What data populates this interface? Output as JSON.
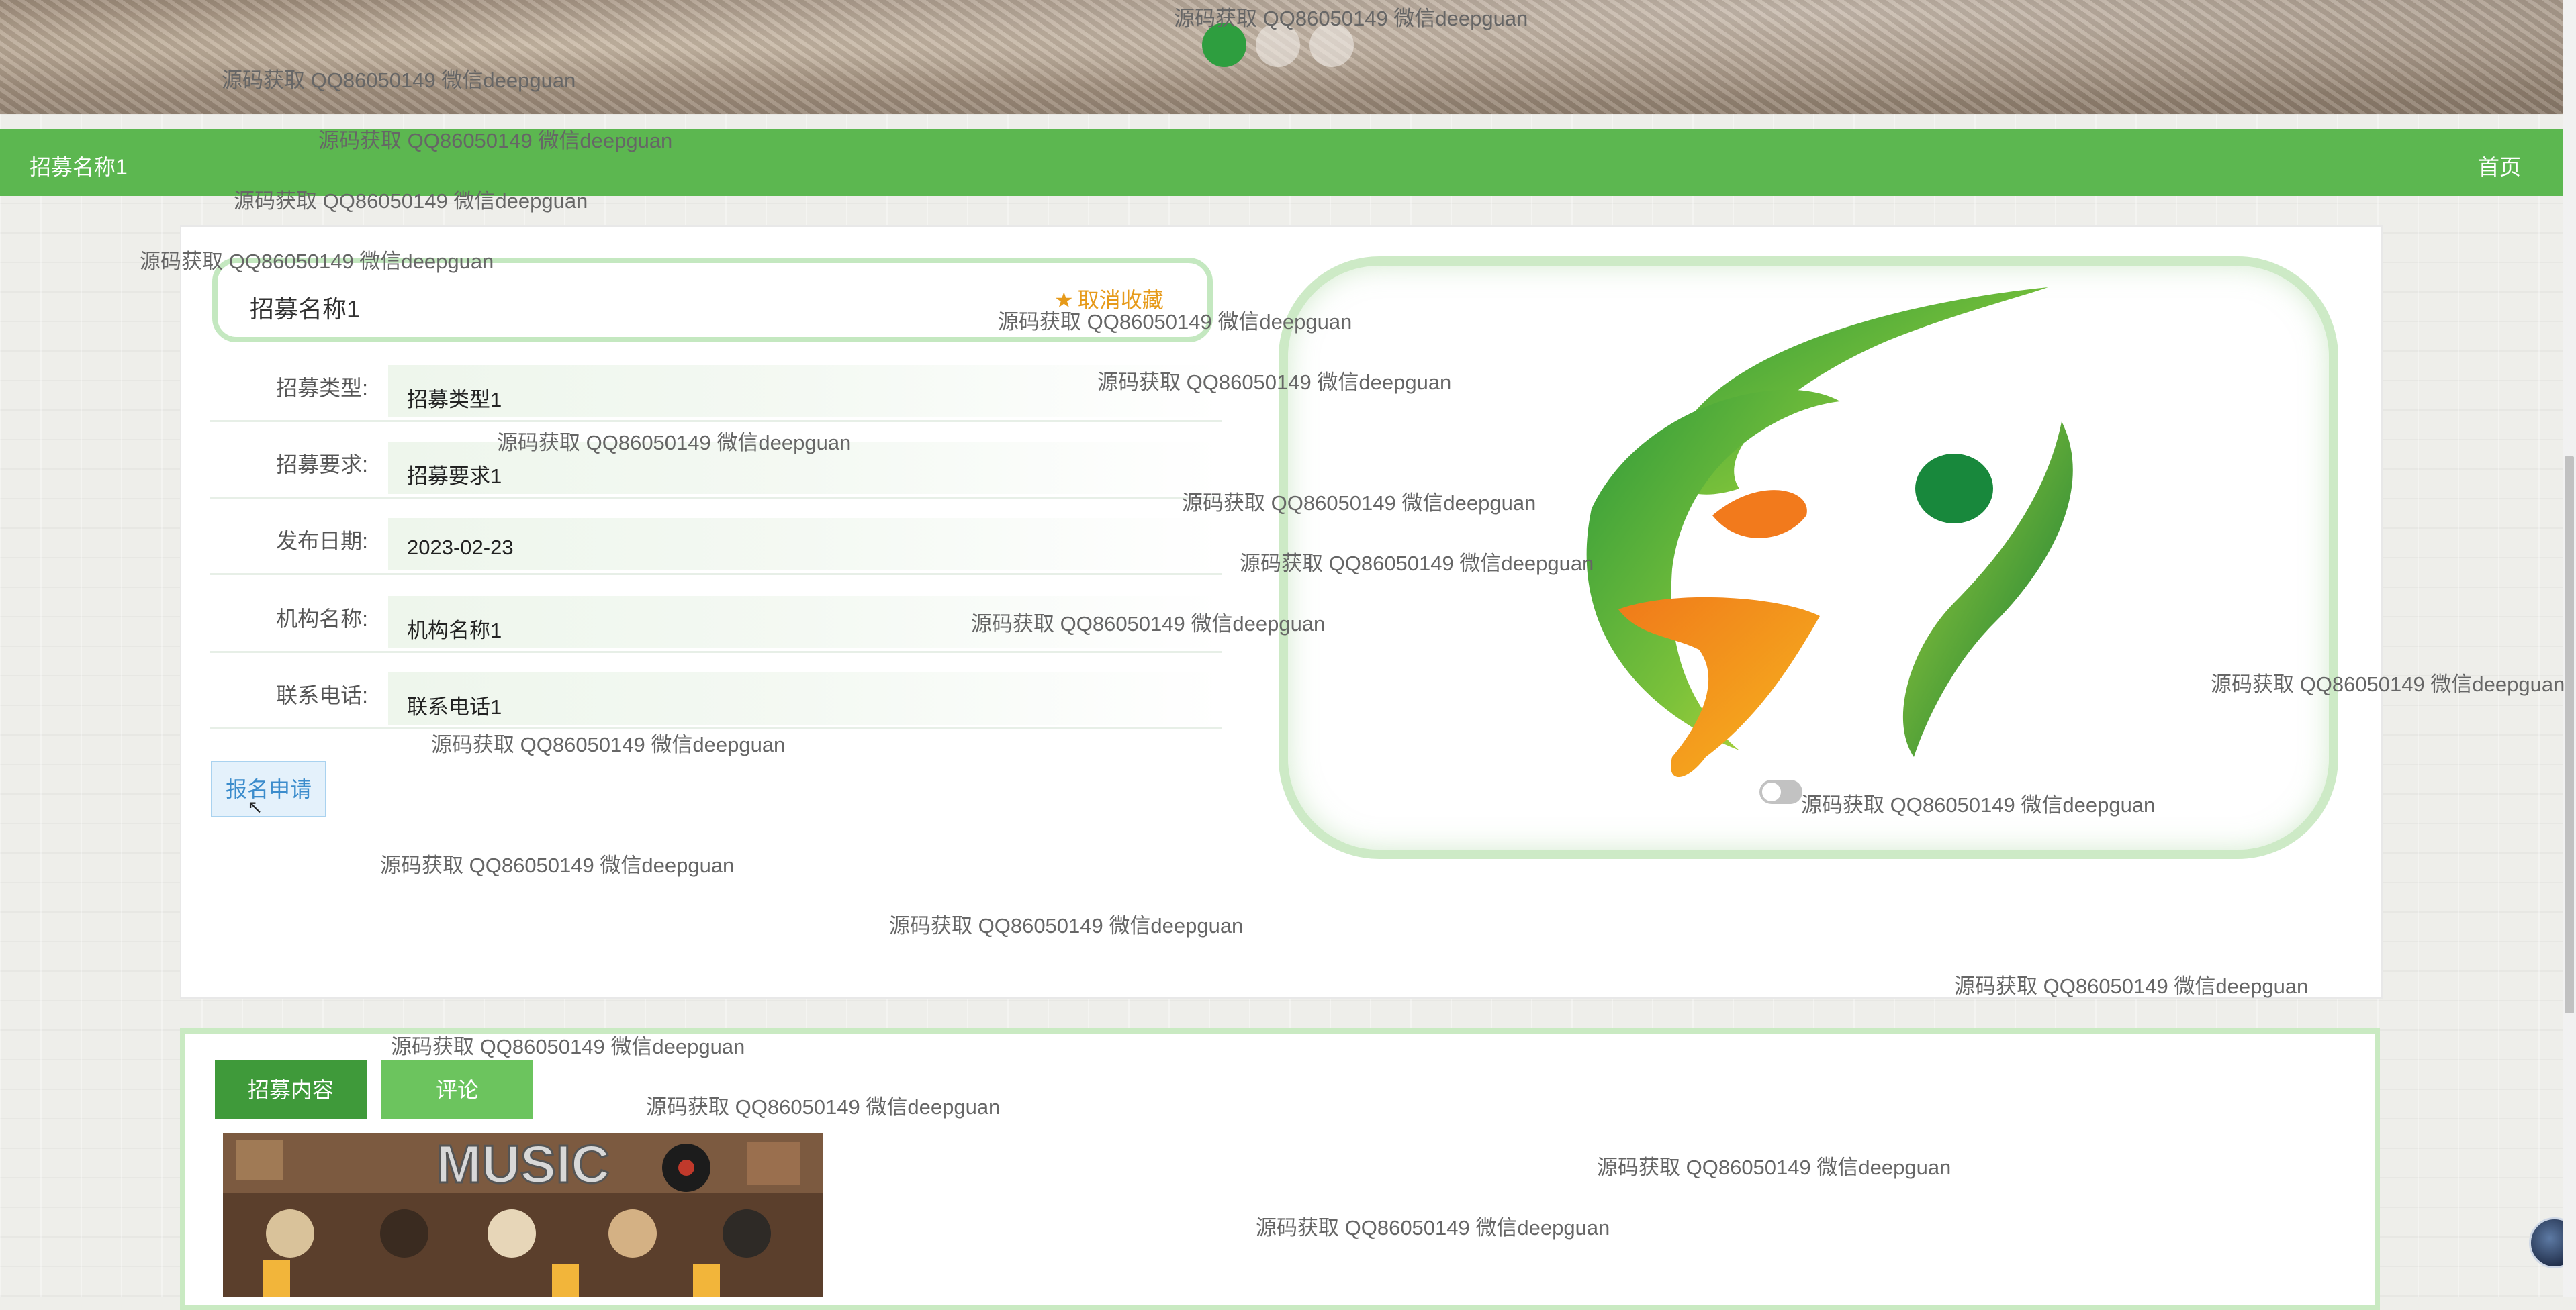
{
  "banner": {
    "dots": [
      true,
      false,
      false
    ]
  },
  "navbar": {
    "title": "招募名称1",
    "home_label": "首页"
  },
  "detail": {
    "name": "招募名称1",
    "favorite_label": "取消收藏",
    "rows": [
      {
        "label": "招募类型:",
        "value": "招募类型1"
      },
      {
        "label": "招募要求:",
        "value": "招募要求1"
      },
      {
        "label": "发布日期:",
        "value": "2023-02-23"
      },
      {
        "label": "机构名称:",
        "value": "机构名称1"
      },
      {
        "label": "联系电话:",
        "value": "联系电话1"
      }
    ],
    "apply_label": "报名申请"
  },
  "tabs": [
    {
      "label": "招募内容",
      "active": true
    },
    {
      "label": "评论",
      "active": false
    }
  ],
  "content_image": {
    "text": "MUSIC"
  },
  "watermark": "源码获取 QQ86050149 微信deepguan",
  "colors": {
    "primary": "#5cb750",
    "tab_active": "#3f9a3a",
    "tab_inactive": "#6cc45e",
    "favorite": "#e69a1a",
    "apply": "#3b8ccc"
  }
}
